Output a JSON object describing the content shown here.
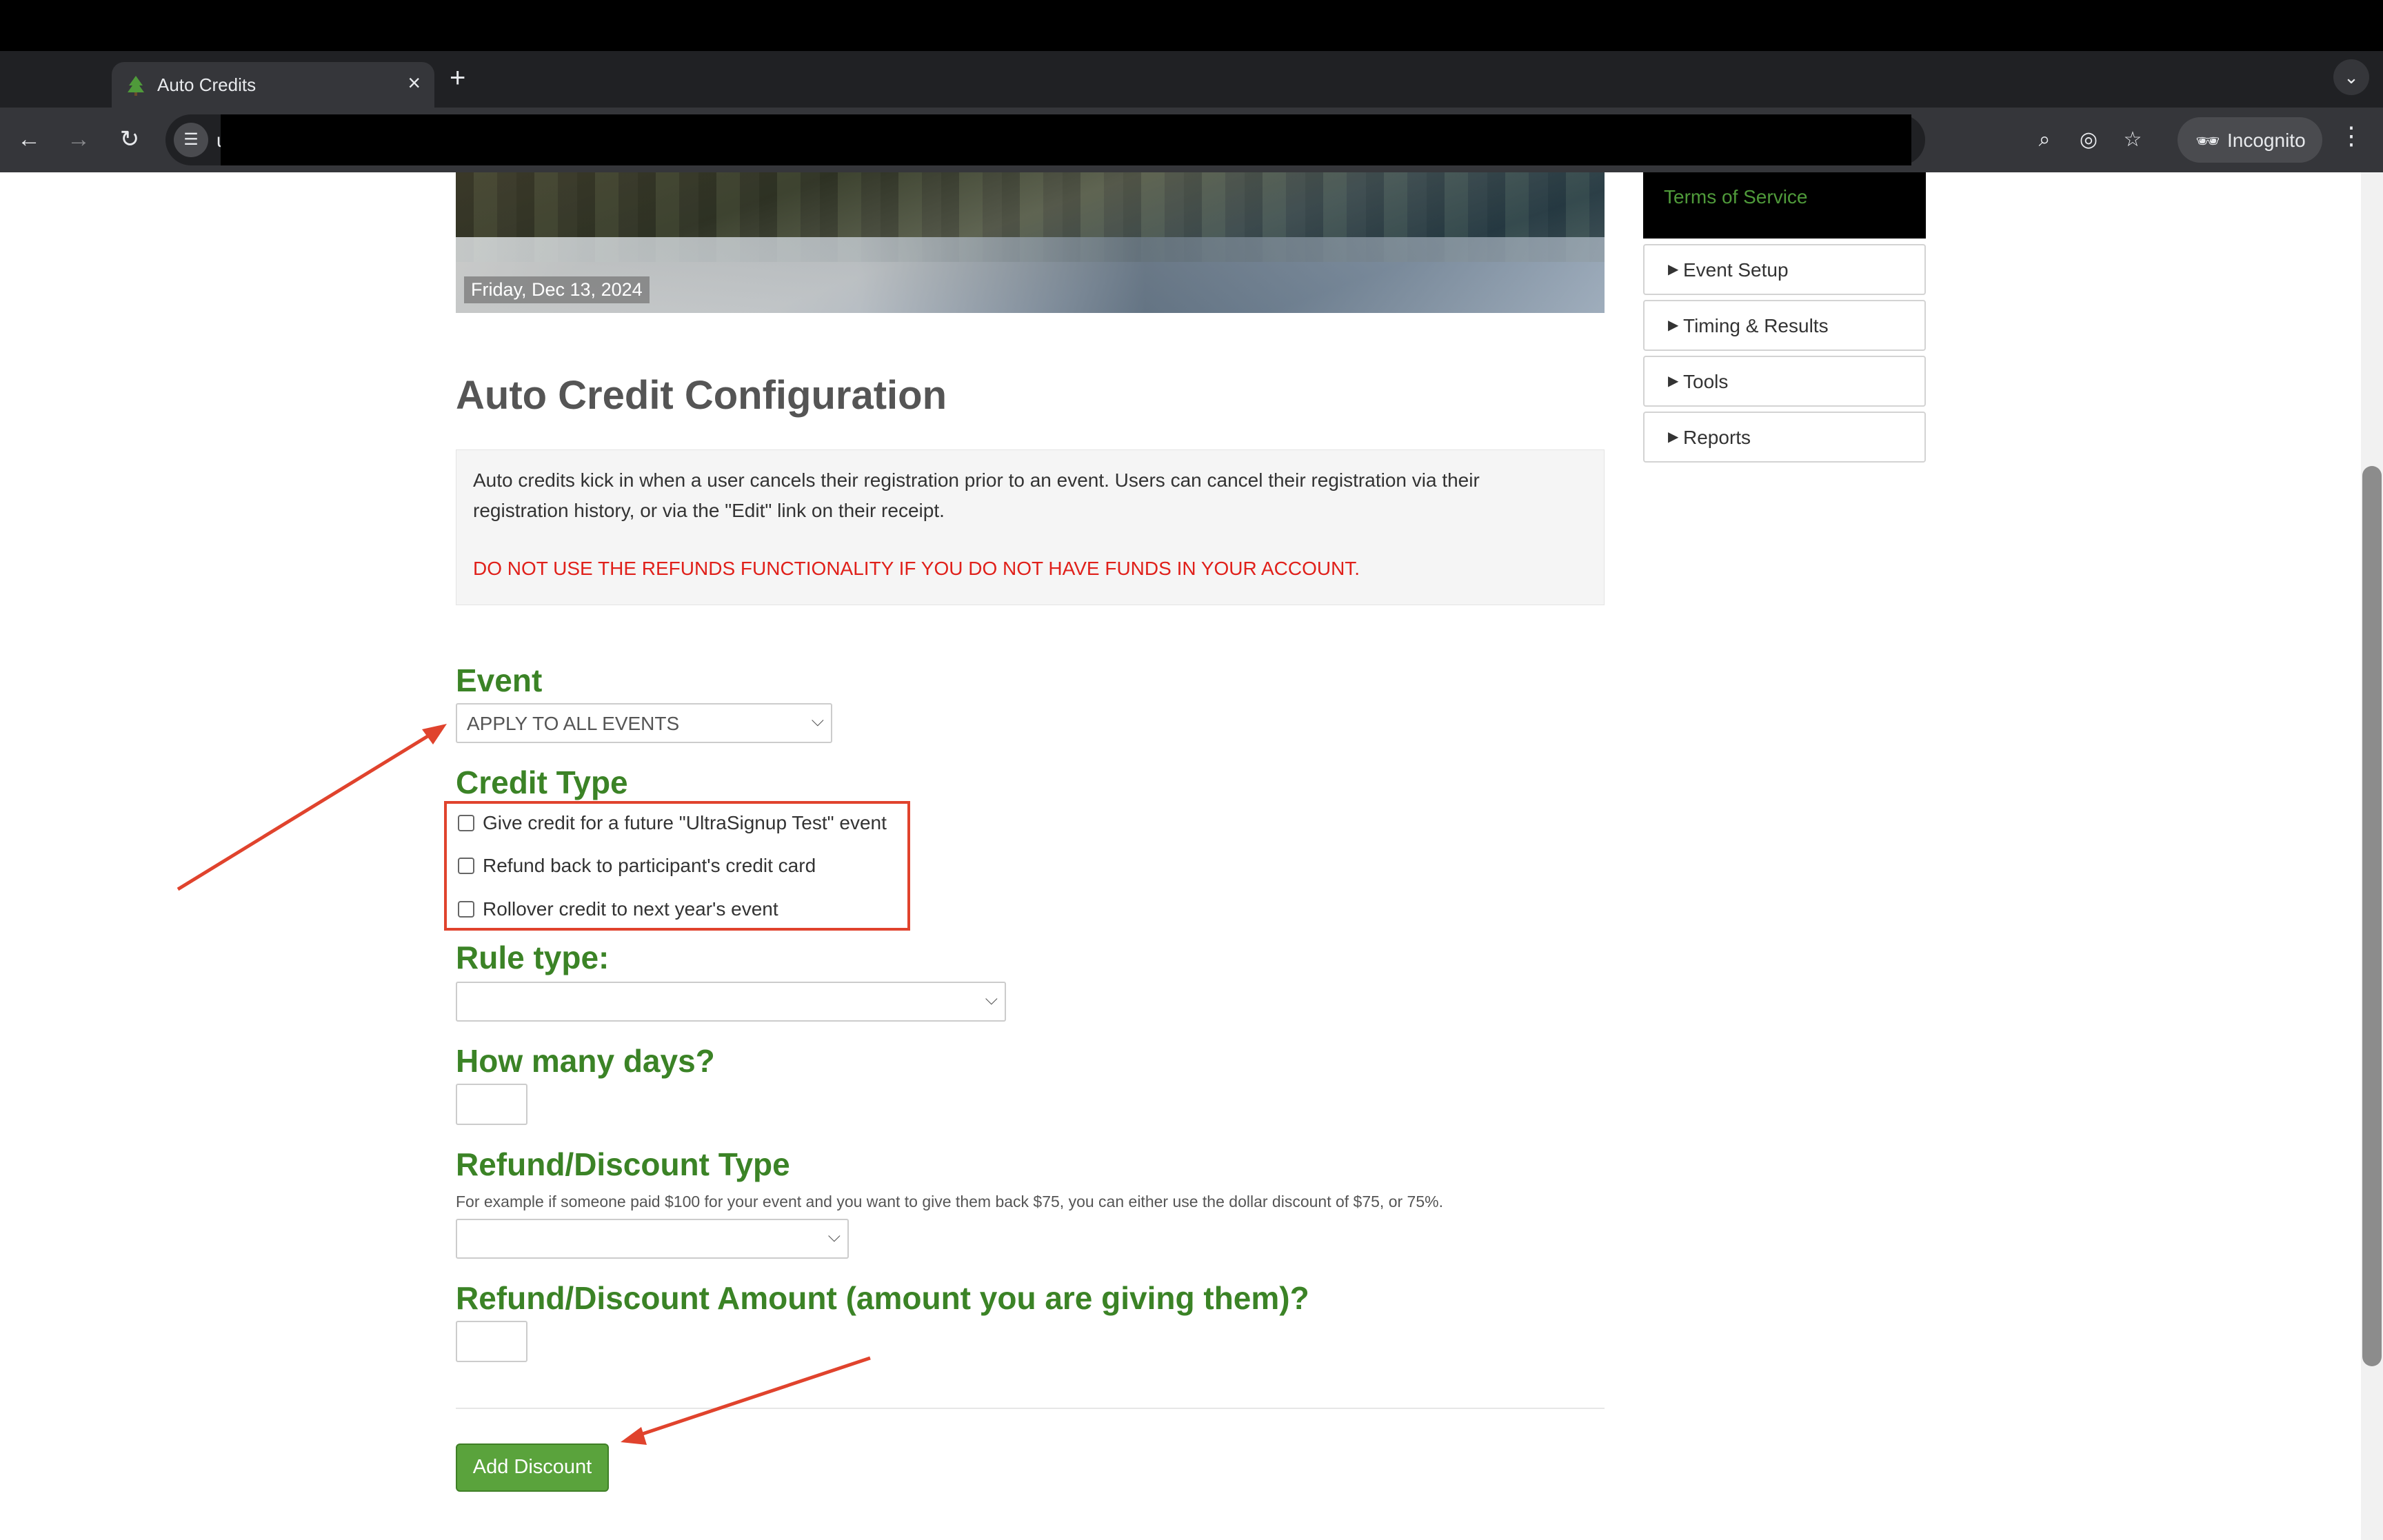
{
  "browser": {
    "tab_title": "Auto Credits",
    "tab_close": "×",
    "new_tab": "+",
    "tab_search": "⌄",
    "back": "←",
    "forward": "→",
    "reload": "↻",
    "url": "u",
    "incognito_label": "Incognito",
    "menu": "⋮",
    "icons": [
      "zoom-icon",
      "eye-slash-icon",
      "star-icon",
      "incognito-icon"
    ]
  },
  "banner": {
    "date": "Friday, Dec 13, 2024"
  },
  "sidebar": {
    "terms": "Terms of Service",
    "items": [
      {
        "label": "Event Setup"
      },
      {
        "label": "Timing & Results"
      },
      {
        "label": "Tools"
      },
      {
        "label": "Reports"
      }
    ]
  },
  "page": {
    "title": "Auto Credit Configuration",
    "notice": "Auto credits kick in when a user cancels their registration prior to an event. Users can cancel their registration via their registration history, or via the \"Edit\" link on their receipt.",
    "warning": "DO NOT USE THE REFUNDS FUNCTIONALITY IF YOU DO NOT HAVE FUNDS IN YOUR ACCOUNT."
  },
  "form": {
    "event_heading": "Event",
    "event_value": "APPLY TO ALL EVENTS",
    "credit_type_heading": "Credit Type",
    "credit_options": [
      {
        "label": "Give credit for a future \"UltraSignup Test\" event",
        "checked": false
      },
      {
        "label": "Refund back to participant's credit card",
        "checked": false
      },
      {
        "label": "Rollover credit to next year's event",
        "checked": false
      }
    ],
    "rule_type_heading": "Rule type:",
    "rule_type_value": "",
    "days_heading": "How many days?",
    "days_value": "",
    "discount_type_heading": "Refund/Discount Type",
    "discount_type_help": "For example if someone paid $100 for your event and you want to give them back $75, you can either use the dollar discount of $75, or 75%.",
    "discount_type_value": "",
    "amount_heading": "Refund/Discount Amount (amount you are giving them)?",
    "amount_value": "",
    "submit_label": "Add Discount"
  },
  "colors": {
    "heading_green": "#3b8326",
    "button_green": "#5aa33c",
    "warning_red": "#e0201a",
    "annotation_red": "#e0432d"
  }
}
